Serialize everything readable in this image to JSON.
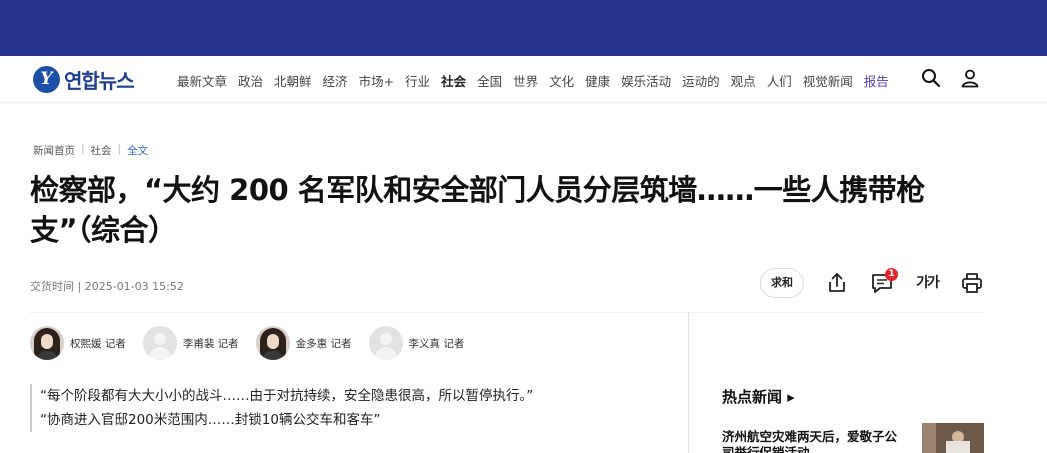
{
  "header": {
    "logo_mark": "Y",
    "logo_text": "연합뉴스",
    "menu": [
      "最新文章",
      "政治",
      "北朝鲜",
      "经济",
      "市场+",
      "行业",
      "社会",
      "全国",
      "世界",
      "文化",
      "健康",
      "娱乐活动",
      "运动的",
      "观点",
      "人们",
      "视觉新闻",
      "报告"
    ],
    "menu_bold_index": 6,
    "menu_accent_index": 16
  },
  "breadcrumb": [
    "新闻首页",
    "社会",
    "全文"
  ],
  "article": {
    "headline": "检察部，“大约 200 名军队和安全部门人员分层筑墙……一些人携带枪支”（综合）",
    "meta": "交货时间 | 2025-01-03 15:52",
    "tools": {
      "pill": "求和",
      "comment_badge": "1",
      "font_label": "가가"
    },
    "reporters": [
      {
        "name": "权熙媛 记者",
        "avatar": "photo"
      },
      {
        "name": "李甫裴 记者",
        "avatar": "blank"
      },
      {
        "name": "金多惠 记者",
        "avatar": "photo"
      },
      {
        "name": "李义真 记者",
        "avatar": "blank"
      }
    ],
    "quotes": [
      "“每个阶段都有大大小小的战斗……由于对抗持续，安全隐患很高，所以暂停执行。”",
      "“协商进入官邸200米范围内……封锁10辆公交车和客车”"
    ]
  },
  "sidebar": {
    "title": "热点新闻",
    "item": "济州航空灾难两天后，爱敬子公",
    "item_next": "司举行促销活动"
  },
  "colors": {
    "band": "#25348d",
    "logo": "#1c4fa6",
    "badge": "#e3262b",
    "accent": "#5a3fb0",
    "link": "#3466c4"
  }
}
